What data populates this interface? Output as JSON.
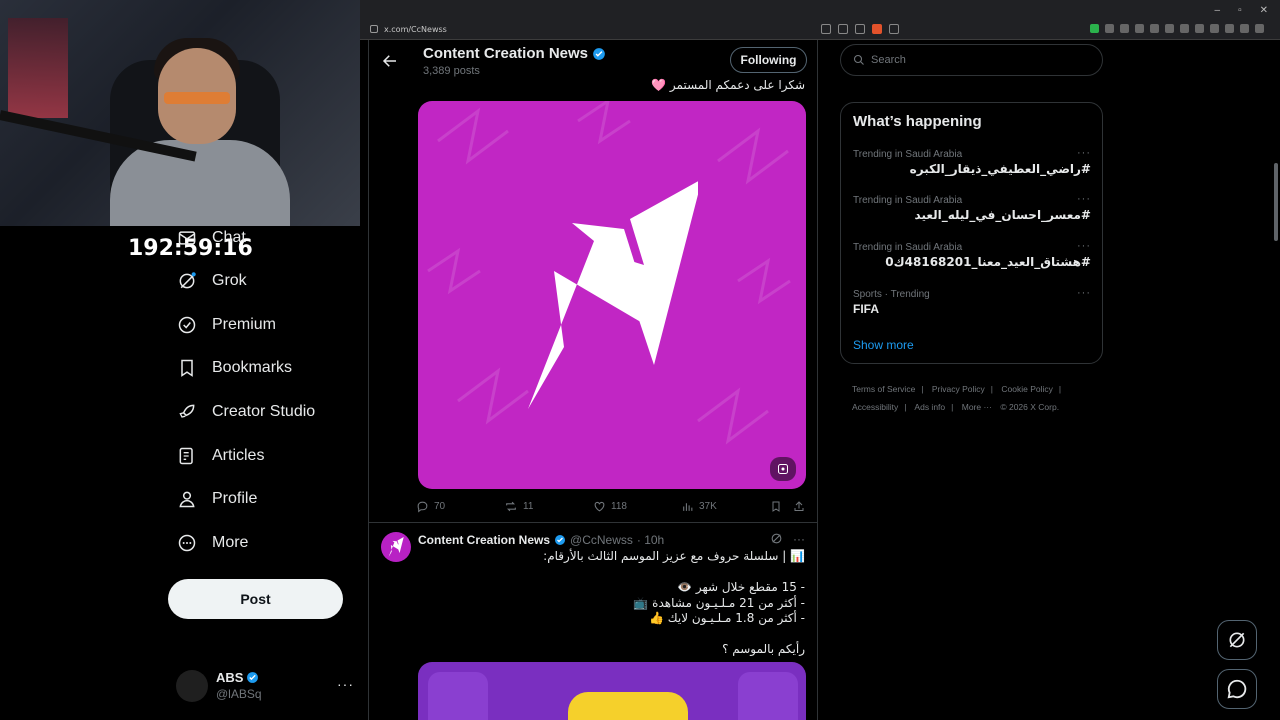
{
  "browser": {
    "url": "x.com/CcNewss",
    "window_controls": [
      "–",
      "▫",
      "✕"
    ]
  },
  "timer": "192:59:16",
  "nav": {
    "items": [
      {
        "label": "Chat",
        "icon": "mail-icon"
      },
      {
        "label": "Grok",
        "icon": "grok-icon"
      },
      {
        "label": "Premium",
        "icon": "premium-icon"
      },
      {
        "label": "Bookmarks",
        "icon": "bookmark-icon"
      },
      {
        "label": "Creator Studio",
        "icon": "rocket-icon"
      },
      {
        "label": "Articles",
        "icon": "articles-icon"
      },
      {
        "label": "Profile",
        "icon": "profile-icon"
      },
      {
        "label": "More",
        "icon": "more-icon"
      }
    ],
    "post_label": "Post"
  },
  "account": {
    "name": "ABS",
    "handle": "@lABSq",
    "menu": "···"
  },
  "profile": {
    "name": "Content Creation News",
    "posts": "3,389 posts",
    "following_label": "Following"
  },
  "tweet1": {
    "text": "شكرا على دعمكم المستمر 🩷",
    "stats": {
      "replies": "70",
      "reposts": "11",
      "likes": "118",
      "views": "37K"
    }
  },
  "tweet2": {
    "author": "Content Creation News",
    "handle": "@CcNewss",
    "time": "· 10h",
    "menu": "···",
    "body": "📊 | سلسلة حروف مع عزيز الموسم الثالث بالأرقام:\n\n- 15 مقطع خلال شهر 👁️\n- أكثر من 21 مـلـيـون مشاهدة 📺\n- أكثر من 1.8 مـلـيـون لايك 👍\n\nرأيكم بالموسم ؟"
  },
  "search": {
    "placeholder": "Search"
  },
  "trends": {
    "title": "What’s happening",
    "menu": "···",
    "items": [
      {
        "meta": "Trending in Saudi Arabia",
        "title": "#راضي_العطيفي_ذيقار_الكبره"
      },
      {
        "meta": "Trending in Saudi Arabia",
        "title": "#معسر_احسان_في_ليله_العيد"
      },
      {
        "meta": "Trending in Saudi Arabia",
        "title": "#هشتاق_العيد_معنا_48168201ك0"
      },
      {
        "meta": "Sports · Trending",
        "title": "FIFA"
      }
    ],
    "show_more": "Show more"
  },
  "footer": {
    "links": [
      "Terms of Service",
      "Privacy Policy",
      "Cookie Policy",
      "Accessibility",
      "Ads info",
      "More ···"
    ],
    "copyright": "© 2026 X Corp."
  },
  "colors": {
    "accent": "#1d9bf0",
    "media_bg": "#c126c4",
    "text": "#e7e9ea",
    "muted": "#71767b"
  }
}
